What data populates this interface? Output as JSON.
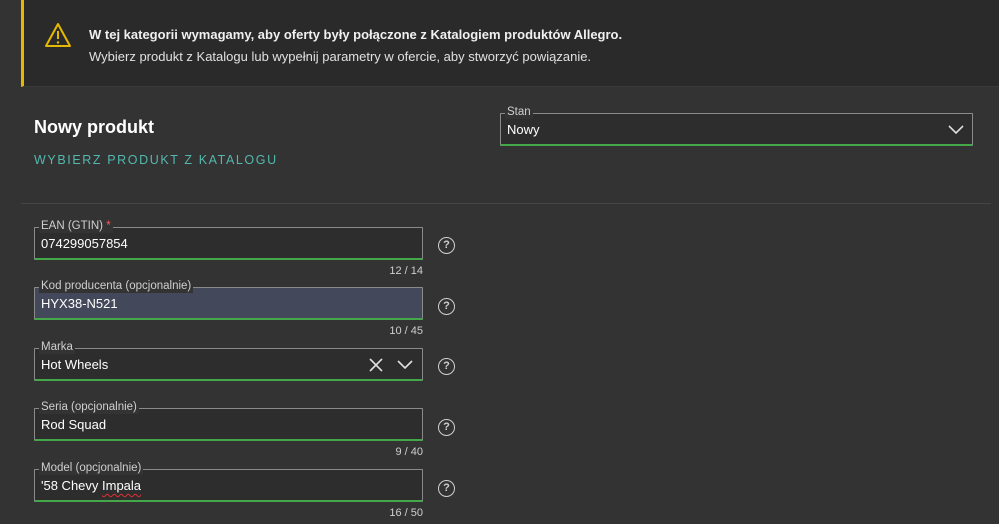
{
  "alert": {
    "title": "W tej kategorii wymagamy, aby oferty były połączone z Katalogiem produktów Allegro.",
    "text": "Wybierz produkt z Katalogu lub wypełnij parametry w ofercie, aby stworzyć powiązanie.",
    "icon": "warning-triangle-icon",
    "accent": "#e6b800"
  },
  "product": {
    "title": "Nowy produkt",
    "catalog_link": "WYBIERZ PRODUKT Z KATALOGU"
  },
  "condition": {
    "label": "Stan",
    "value": "Nowy"
  },
  "fields": {
    "ean": {
      "label": "EAN (GTIN)",
      "required_mark": "*",
      "value": "074299057854",
      "counter": "12  /  14"
    },
    "manufacturer_code": {
      "label": "Kod producenta (opcjonalnie)",
      "value": "HYX38-N521",
      "counter": "10  /  45"
    },
    "brand": {
      "label": "Marka",
      "value": "Hot Wheels"
    },
    "series": {
      "label": "Seria (opcjonalnie)",
      "value": "Rod Squad",
      "counter": "9  /  40"
    },
    "model": {
      "label": "Model (opcjonalnie)",
      "value_prefix": "'58 Chevy ",
      "value_misspelled": "Impala",
      "counter": "16  /  50"
    }
  },
  "help_glyph": "?",
  "colors": {
    "valid_border": "#44a84b",
    "link": "#53b8ad",
    "required": "#ff5a5a"
  }
}
